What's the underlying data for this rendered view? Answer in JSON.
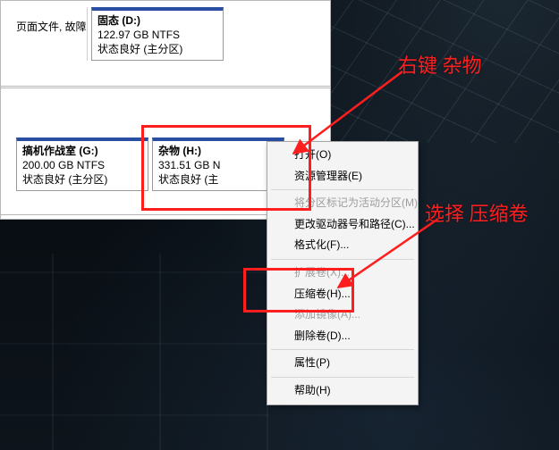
{
  "volumes": {
    "c_frag": {
      "line1": "",
      "line2": "页面文件, 故障"
    },
    "d": {
      "label": "固态   (D:)",
      "size": "122.97 GB NTFS",
      "status": "状态良好 (主分区)"
    },
    "g": {
      "label": "搞机作战室   (G:)",
      "size": "200.00 GB NTFS",
      "status": "状态良好 (主分区)"
    },
    "h": {
      "label": "杂物   (H:)",
      "size": "331.51 GB N",
      "status": "状态良好 (主"
    }
  },
  "context_menu": {
    "open": "打开(O)",
    "explorer": "资源管理器(E)",
    "mark_active": "将分区标记为活动分区(M)",
    "change_letter": "更改驱动器号和路径(C)...",
    "format": "格式化(F)...",
    "extend": "扩展卷(X)...",
    "shrink": "压缩卷(H)...",
    "add_mirror": "添加镜像(A)...",
    "delete": "删除卷(D)...",
    "properties": "属性(P)",
    "help": "帮助(H)"
  },
  "annotations": {
    "right_click": "右键  杂物",
    "choose": "选择  压缩卷"
  }
}
